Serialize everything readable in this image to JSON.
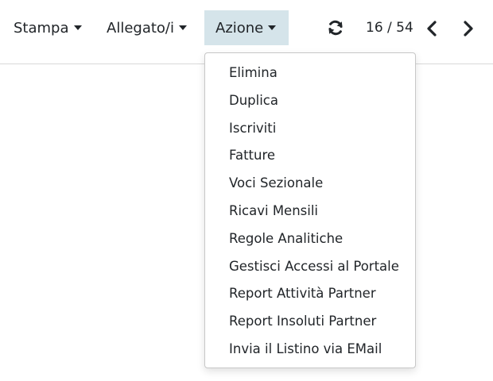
{
  "toolbar": {
    "print_label": "Stampa",
    "attachments_label": "Allegato/i",
    "action_label": "Azione",
    "pager": "16 / 54"
  },
  "icons": {
    "refresh": "refresh-icon",
    "previous": "chevron-left-icon",
    "next": "chevron-right-icon",
    "caret": "caret-down-icon"
  },
  "colors": {
    "active_button_bg": "#d5e4ea",
    "text": "#212529"
  },
  "action_menu": {
    "items": [
      {
        "label": "Elimina"
      },
      {
        "label": "Duplica"
      },
      {
        "label": "Iscriviti"
      },
      {
        "label": "Fatture"
      },
      {
        "label": "Voci Sezionale"
      },
      {
        "label": "Ricavi Mensili"
      },
      {
        "label": "Regole Analitiche"
      },
      {
        "label": "Gestisci Accessi al Portale"
      },
      {
        "label": "Report Attività Partner"
      },
      {
        "label": "Report Insoluti Partner"
      },
      {
        "label": "Invia il Listino via EMail"
      }
    ]
  }
}
